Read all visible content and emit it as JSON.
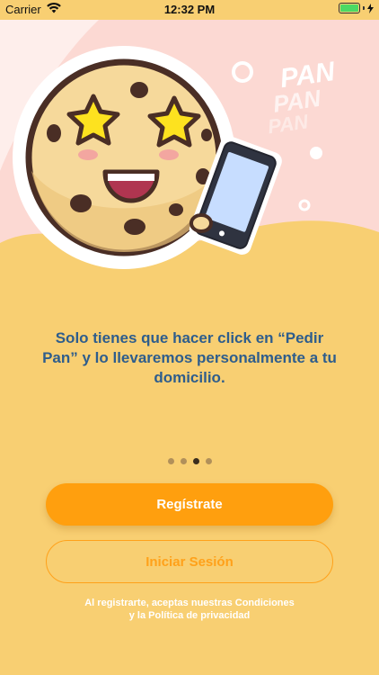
{
  "status_bar": {
    "carrier": "Carrier",
    "time": "12:32 PM",
    "icons": [
      "wifi-icon",
      "battery-icon",
      "charging-bolt-icon"
    ]
  },
  "hero": {
    "brand_words": [
      "PAN",
      "PAN",
      "PAN"
    ],
    "illustration": "cookie-character-with-star-eyes-holding-phone"
  },
  "message": {
    "line1": "Solo tienes que hacer click en “Pedir",
    "line2": "Pan” y lo llevaremos personalmente a tu",
    "line3": "domicilio."
  },
  "pager": {
    "total": 4,
    "active_index": 2
  },
  "actions": {
    "register_label": "Regístrate",
    "login_label": "Iniciar Sesión"
  },
  "legal": {
    "line1": "Al registrarte, aceptas nuestras Condiciones",
    "line2": "y la Política de privacidad"
  },
  "colors": {
    "background": "#f8cf72",
    "hero_pink": "#fcd9d3",
    "primary_button": "#ff9f0e",
    "outline_button": "#ffa11a",
    "message_text": "#2e5d8c",
    "active_dot": "#3a2d1d",
    "inactive_dot": "#b1905a"
  }
}
